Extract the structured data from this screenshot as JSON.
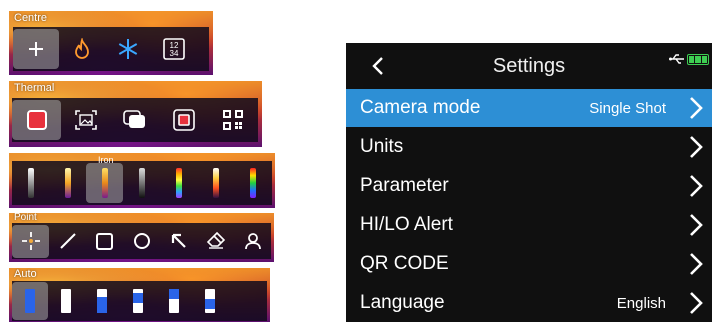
{
  "toolbars": {
    "centre": {
      "label": "Centre",
      "buttons": [
        "crosshair",
        "flame",
        "snowflake",
        "numbers"
      ],
      "numbers_icon_text": "12\n34"
    },
    "thermal": {
      "label": "Thermal"
    },
    "palette": {
      "label": "Iron"
    },
    "point": {
      "label": "Point"
    },
    "auto": {
      "label": "Auto"
    }
  },
  "settings": {
    "title": "Settings",
    "items": [
      {
        "label": "Camera mode",
        "value": "Single Shot",
        "selected": true
      },
      {
        "label": "Units",
        "value": ""
      },
      {
        "label": "Parameter",
        "value": ""
      },
      {
        "label": "HI/LO Alert",
        "value": ""
      },
      {
        "label": "QR CODE",
        "value": ""
      },
      {
        "label": "Language",
        "value": "English"
      }
    ]
  },
  "colors": {
    "selected_row": "#2d8fd5",
    "screen_bg": "#101010",
    "battery": "#3ecf52",
    "record_red": "#e8313d",
    "auto_blue": "#2a64e8"
  }
}
